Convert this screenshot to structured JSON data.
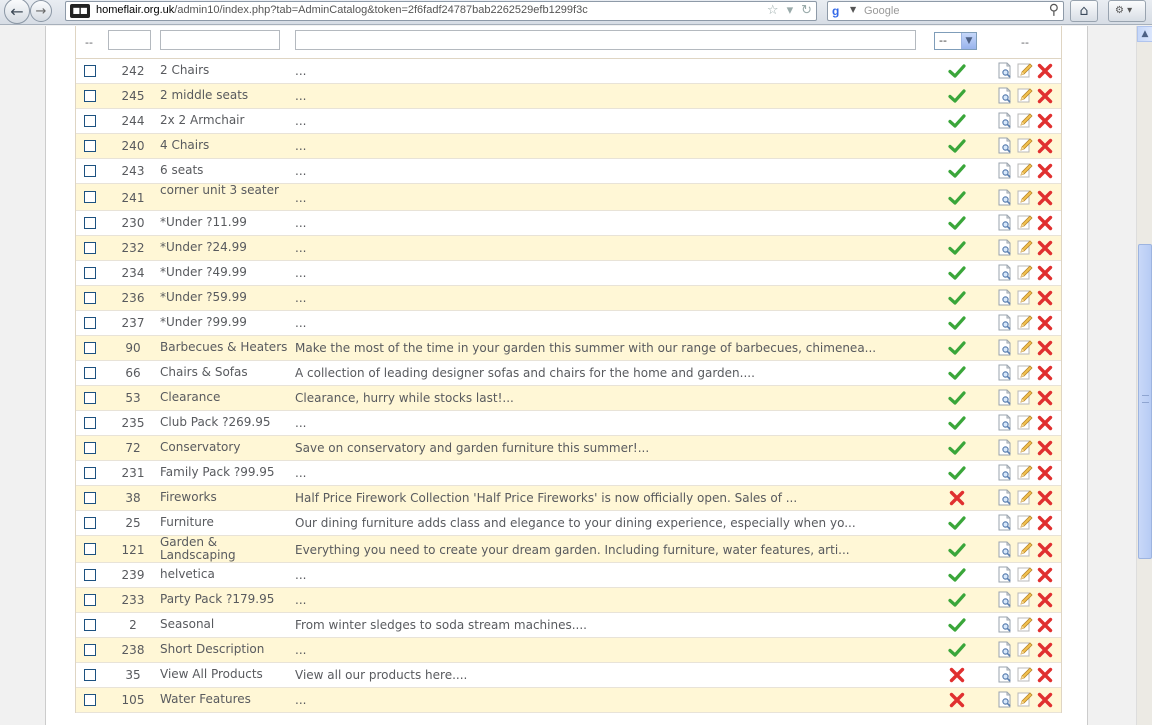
{
  "browser": {
    "url_host": "homeflair.org.uk",
    "url_path": "/admin10/index.php?tab=AdminCatalog&token=2f6fadf24787bab2262529efb1299f3c",
    "search_placeholder": "Google"
  },
  "filters": {
    "select_value": "--",
    "leading_dash": "--",
    "trailing_dash": "--"
  },
  "rows": [
    {
      "id": "242",
      "name": "2 Chairs",
      "desc": "...",
      "active": true
    },
    {
      "id": "245",
      "name": "2 middle seats",
      "desc": "...",
      "active": true
    },
    {
      "id": "244",
      "name": "2x 2 Armchair",
      "desc": "...",
      "active": true
    },
    {
      "id": "240",
      "name": "4 Chairs",
      "desc": "...",
      "active": true
    },
    {
      "id": "243",
      "name": "6 seats",
      "desc": "...",
      "active": true
    },
    {
      "id": "241",
      "name": "corner unit 3 seater",
      "desc": "...",
      "active": true
    },
    {
      "id": "230",
      "name": "*Under ?11.99",
      "desc": "...",
      "active": true
    },
    {
      "id": "232",
      "name": "*Under ?24.99",
      "desc": "...",
      "active": true
    },
    {
      "id": "234",
      "name": "*Under ?49.99",
      "desc": "...",
      "active": true
    },
    {
      "id": "236",
      "name": "*Under ?59.99",
      "desc": "...",
      "active": true
    },
    {
      "id": "237",
      "name": "*Under ?99.99",
      "desc": "...",
      "active": true
    },
    {
      "id": "90",
      "name": "Barbecues & Heaters",
      "desc": "Make the most of the time in your garden this summer with our range of barbecues, chimenea...",
      "active": true
    },
    {
      "id": "66",
      "name": "Chairs & Sofas",
      "desc": "A collection of leading designer sofas and chairs for the home and garden....",
      "active": true
    },
    {
      "id": "53",
      "name": "Clearance",
      "desc": "Clearance, hurry while stocks last!...",
      "active": true
    },
    {
      "id": "235",
      "name": "Club Pack ?269.95",
      "desc": "...",
      "active": true
    },
    {
      "id": "72",
      "name": "Conservatory",
      "desc": "Save on conservatory and garden furniture this summer!...",
      "active": true
    },
    {
      "id": "231",
      "name": "Family Pack ?99.95",
      "desc": "...",
      "active": true
    },
    {
      "id": "38",
      "name": "Fireworks",
      "desc": "Half Price Firework Collection 'Half Price Fireworks' is now officially open. Sales of ...",
      "active": false
    },
    {
      "id": "25",
      "name": "Furniture",
      "desc": "Our dining furniture adds class and elegance to your dining experience, especially when yo...",
      "active": true
    },
    {
      "id": "121",
      "name": "Garden & Landscaping",
      "desc": "Everything you need to create your dream garden. Including furniture, water features, arti...",
      "active": true
    },
    {
      "id": "239",
      "name": "helvetica",
      "desc": "...",
      "active": true
    },
    {
      "id": "233",
      "name": "Party Pack ?179.95",
      "desc": "...",
      "active": true
    },
    {
      "id": "2",
      "name": "Seasonal",
      "desc": "From winter sledges to soda stream machines....",
      "active": true
    },
    {
      "id": "238",
      "name": "Short Description",
      "desc": "...",
      "active": true
    },
    {
      "id": "35",
      "name": "View All Products",
      "desc": "View all our products here....",
      "active": false
    },
    {
      "id": "105",
      "name": "Water Features",
      "desc": "...",
      "active": false
    }
  ],
  "colors": {
    "row_alt": "#fff7d6",
    "check_green": "#3aa63a",
    "cross_red": "#e03030"
  }
}
